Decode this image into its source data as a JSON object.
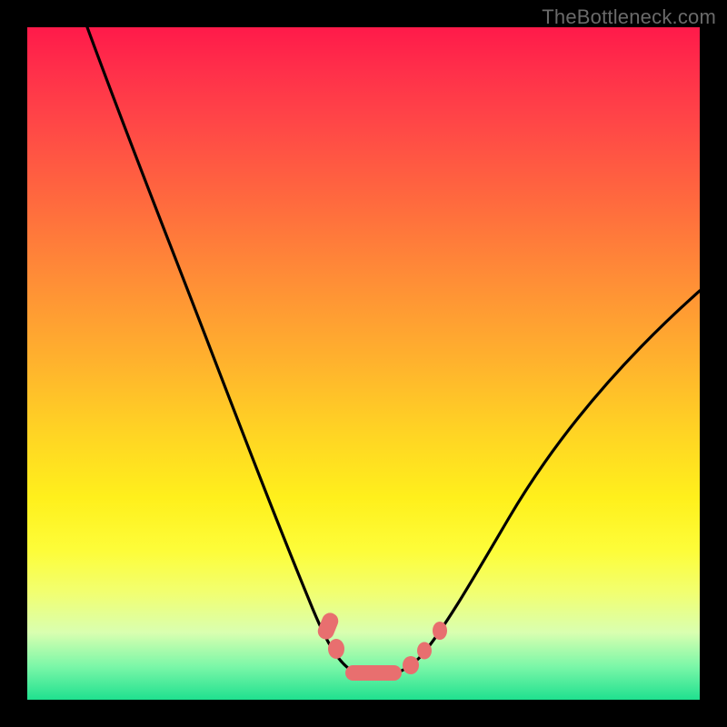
{
  "watermark": "TheBottleneck.com",
  "colors": {
    "background": "#000000",
    "gradient_top": "#ff1a4a",
    "gradient_bottom": "#1fe08f",
    "curve_stroke": "#000000",
    "marker_fill": "#e86f6f"
  },
  "chart_data": {
    "type": "line",
    "title": "",
    "xlabel": "",
    "ylabel": "",
    "xlim": [
      0,
      100
    ],
    "ylim": [
      0,
      100
    ],
    "grid": false,
    "note": "Axes unlabeled in image. x is horizontal position (0–100 left→right), y is vertical value (0 at bottom, 100 at top). Values estimated from pixel positions.",
    "series": [
      {
        "name": "curve",
        "x": [
          9,
          16,
          22,
          28,
          34,
          38,
          42,
          45,
          47,
          49,
          51,
          55,
          58,
          61,
          64,
          70,
          78,
          86,
          94,
          100
        ],
        "y": [
          100,
          82,
          67,
          52,
          37,
          27,
          17,
          10,
          6,
          4,
          4,
          4,
          6,
          9,
          13,
          22,
          34,
          45,
          54,
          61
        ]
      }
    ],
    "markers": {
      "description": "Salmon rounded markers along the curve near the valley, estimated centers.",
      "points": [
        {
          "x": 44.5,
          "y": 11.5
        },
        {
          "x": 46.5,
          "y": 7.5
        },
        {
          "x": 49.0,
          "y": 4.3
        },
        {
          "x": 52.5,
          "y": 4.0
        },
        {
          "x": 56.0,
          "y": 4.3
        },
        {
          "x": 59.0,
          "y": 7.0
        },
        {
          "x": 61.5,
          "y": 10.0
        }
      ]
    }
  }
}
